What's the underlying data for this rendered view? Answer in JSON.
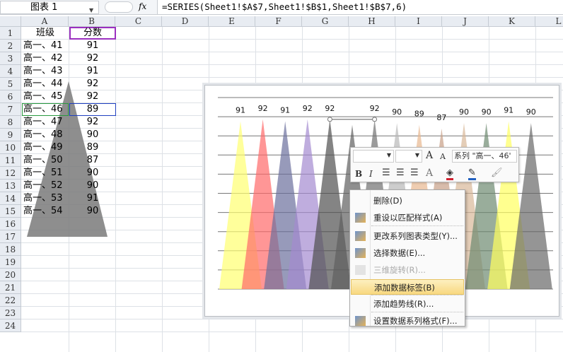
{
  "formula_bar": {
    "name_box": "图表 1",
    "fx": "fx",
    "formula": "=SERIES(Sheet1!$A$7,Sheet1!$B$1,Sheet1!$B$7,6)"
  },
  "columns": [
    "A",
    "B",
    "C",
    "D",
    "E",
    "F",
    "G",
    "H",
    "I",
    "J",
    "K",
    "L"
  ],
  "rows": [
    "1",
    "2",
    "3",
    "4",
    "5",
    "6",
    "7",
    "8",
    "9",
    "10",
    "11",
    "12",
    "13",
    "14",
    "15",
    "16",
    "17",
    "18",
    "19",
    "20",
    "21",
    "22",
    "23",
    "24"
  ],
  "headers": {
    "a": "班级",
    "b": "分数"
  },
  "table": [
    {
      "cls": "高一、41",
      "score": "91"
    },
    {
      "cls": "高一、42",
      "score": "92"
    },
    {
      "cls": "高一、43",
      "score": "91"
    },
    {
      "cls": "高一、44",
      "score": "92"
    },
    {
      "cls": "高一、45",
      "score": "92"
    },
    {
      "cls": "高一、46",
      "score": "89"
    },
    {
      "cls": "高一、47",
      "score": "92"
    },
    {
      "cls": "高一、48",
      "score": "90"
    },
    {
      "cls": "高一、49",
      "score": "89"
    },
    {
      "cls": "高一、50",
      "score": "87"
    },
    {
      "cls": "高一、51",
      "score": "90"
    },
    {
      "cls": "高一、52",
      "score": "90"
    },
    {
      "cls": "高一、53",
      "score": "91"
    },
    {
      "cls": "高一、54",
      "score": "90"
    }
  ],
  "chart_data": {
    "type": "area",
    "categories": [
      "高一、41",
      "高一、42",
      "高一、43",
      "高一、44",
      "高一、45",
      "高一、46",
      "高一、47",
      "高一、48",
      "高一、49",
      "高一、50",
      "高一、51",
      "高一、52",
      "高一、53",
      "高一、54"
    ],
    "values": [
      91,
      92,
      91,
      92,
      92,
      89,
      92,
      90,
      89,
      87,
      90,
      90,
      91,
      90
    ],
    "labels_shown": [
      true,
      true,
      true,
      true,
      true,
      false,
      true,
      true,
      true,
      true,
      true,
      true,
      true,
      true
    ],
    "colors": [
      "#ffff70",
      "#ff6a6a",
      "#6b6f9c",
      "#a48ad0",
      "#505050",
      "#606060",
      "#707070",
      "#b8b8b8",
      "#e8b890",
      "#c8a088",
      "#d8b898",
      "#6d8a70",
      "#ffff60",
      "#686868"
    ],
    "grid": true,
    "selected_series": "高一、46"
  },
  "mini_toolbar": {
    "series_select": "系列 \"高一、46'",
    "bold": "B",
    "italic": "I",
    "font_color": "A",
    "grow": "A",
    "shrink": "A"
  },
  "context_menu": [
    {
      "label": "删除(D)",
      "icon": "",
      "disabled": false
    },
    {
      "label": "重设以匹配样式(A)",
      "icon": "reset-style-icon",
      "disabled": false
    },
    {
      "label": "更改系列图表类型(Y)...",
      "icon": "chart-type-icon",
      "disabled": false
    },
    {
      "label": "选择数据(E)...",
      "icon": "select-data-icon",
      "disabled": false
    },
    {
      "label": "三维旋转(R)...",
      "icon": "3d-rotate-icon",
      "disabled": true
    },
    {
      "label": "添加数据标签(B)",
      "icon": "",
      "disabled": false,
      "highlighted": true
    },
    {
      "label": "添加趋势线(R)...",
      "icon": "",
      "disabled": false
    },
    {
      "label": "设置数据系列格式(F)...",
      "icon": "format-series-icon",
      "disabled": false
    }
  ]
}
